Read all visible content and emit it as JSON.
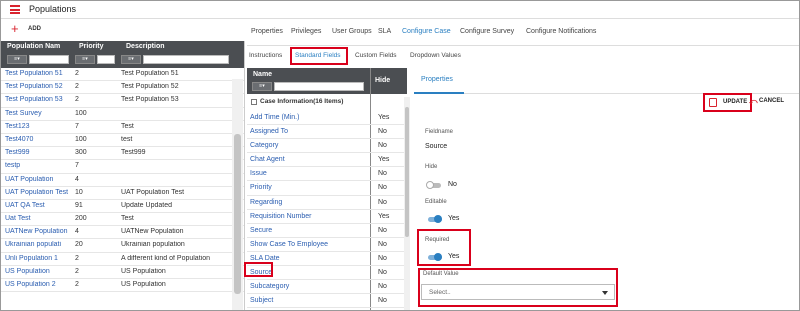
{
  "app": {
    "title": "Populations"
  },
  "left": {
    "add_label": "ADD",
    "columns": [
      "Population Nam",
      "Priority",
      "Description"
    ],
    "rows": [
      {
        "name": "Test Population 51",
        "priority": "2",
        "desc": "Test Population 51"
      },
      {
        "name": "Test Population 52",
        "priority": "2",
        "desc": "Test Population 52"
      },
      {
        "name": "Test Population 53",
        "priority": "2",
        "desc": "Test Population 53"
      },
      {
        "name": "Test Survey",
        "priority": "100",
        "desc": ""
      },
      {
        "name": "Test123",
        "priority": "7",
        "desc": "Test"
      },
      {
        "name": "Test4070",
        "priority": "100",
        "desc": "test"
      },
      {
        "name": "Test999",
        "priority": "300",
        "desc": "Test999"
      },
      {
        "name": "testp",
        "priority": "7",
        "desc": ""
      },
      {
        "name": "UAT Population",
        "priority": "4",
        "desc": ""
      },
      {
        "name": "UAT Population Test",
        "priority": "10",
        "desc": "UAT Population Test"
      },
      {
        "name": "UAT QA Test",
        "priority": "91",
        "desc": "Update Updated"
      },
      {
        "name": "Uat Test",
        "priority": "200",
        "desc": "Test"
      },
      {
        "name": "UATNew Population",
        "priority": "4",
        "desc": "UATNew Population"
      },
      {
        "name": "Ukrainian populati",
        "priority": "20",
        "desc": "Ukrainian population"
      },
      {
        "name": "Unli Population 1",
        "priority": "2",
        "desc": "A different kind of Population"
      },
      {
        "name": "US Population",
        "priority": "2",
        "desc": "US Population"
      },
      {
        "name": "US Population 2",
        "priority": "2",
        "desc": "US Population"
      }
    ]
  },
  "tabs": [
    "Properties",
    "Privileges",
    "User Groups",
    "SLA",
    "Configure Case",
    "Configure Survey",
    "Configure Notifications"
  ],
  "subtabs": [
    "Instructions",
    "Standard Fields",
    "Custom Fields",
    "Dropdown Values"
  ],
  "fields": {
    "col_name": "Name",
    "col_hide": "Hide",
    "group_label": "Case Information(16 Items)",
    "rows": [
      {
        "name": "Add Time (Min.)",
        "hide": "Yes"
      },
      {
        "name": "Assigned To",
        "hide": "No"
      },
      {
        "name": "Category",
        "hide": "No"
      },
      {
        "name": "Chat Agent",
        "hide": "Yes"
      },
      {
        "name": "Issue",
        "hide": "No"
      },
      {
        "name": "Priority",
        "hide": "No"
      },
      {
        "name": "Regarding",
        "hide": "No"
      },
      {
        "name": "Requisition Number",
        "hide": "Yes"
      },
      {
        "name": "Secure",
        "hide": "No"
      },
      {
        "name": "Show Case To Employee",
        "hide": "No"
      },
      {
        "name": "SLA Date",
        "hide": "No"
      },
      {
        "name": "Source",
        "hide": "No"
      },
      {
        "name": "Subcategory",
        "hide": "No"
      },
      {
        "name": "Subject",
        "hide": "No"
      }
    ]
  },
  "properties": {
    "tab": "Properties",
    "update": "UPDATE",
    "cancel": "CANCEL",
    "fieldname_label": "Fieldname",
    "fieldname_value": "Source",
    "hide_label": "Hide",
    "hide_value": "No",
    "editable_label": "Editable",
    "editable_value": "Yes",
    "required_label": "Required",
    "required_value": "Yes",
    "default_label": "Default Value",
    "default_placeholder": "Select.."
  },
  "colors": {
    "accent": "#2a7fc1",
    "header": "#4b4e52",
    "brand": "#d9232e",
    "highlight": "#d9001b"
  }
}
